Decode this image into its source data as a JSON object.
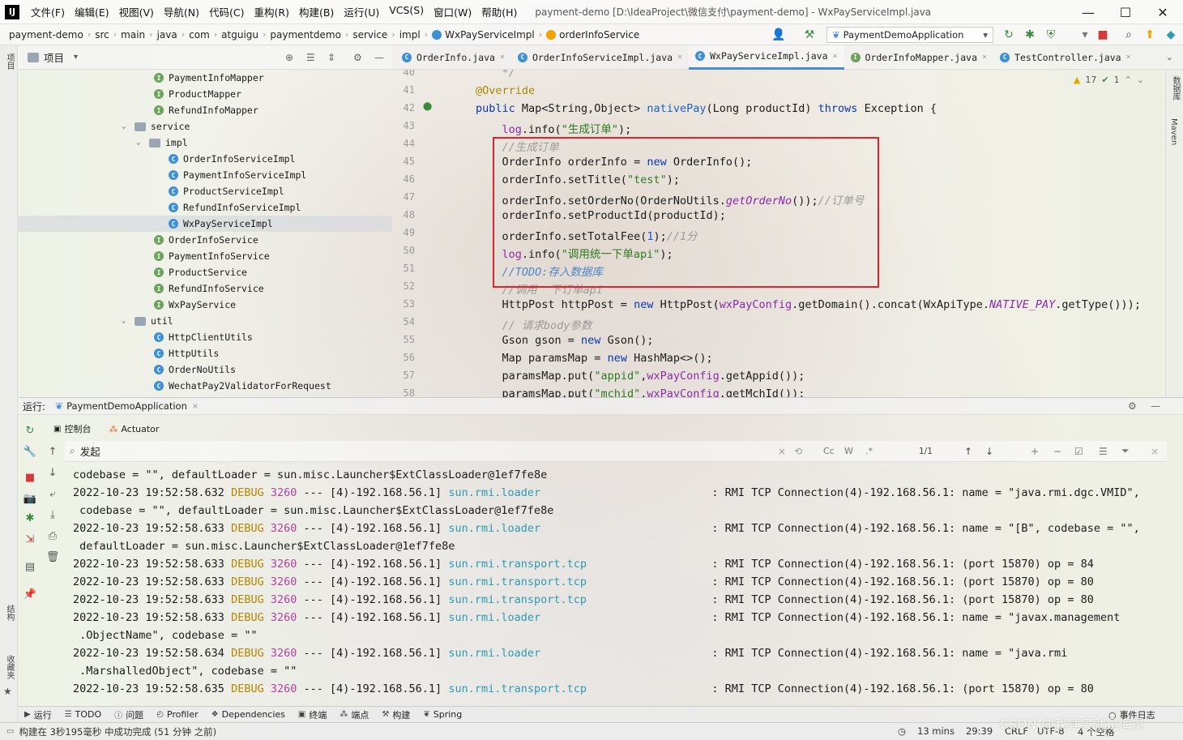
{
  "window": {
    "title": "payment-demo [D:\\IdeaProject\\微信支付\\payment-demo] - WxPayServiceImpl.java",
    "logo": "IJ",
    "controls": {
      "minimize": "—",
      "maximize": "☐",
      "close": "✕"
    }
  },
  "menu": [
    "文件(F)",
    "编辑(E)",
    "视图(V)",
    "导航(N)",
    "代码(C)",
    "重构(R)",
    "构建(B)",
    "运行(U)",
    "VCS(S)",
    "窗口(W)",
    "帮助(H)"
  ],
  "breadcrumbs": [
    "payment-demo",
    "src",
    "main",
    "java",
    "com",
    "atguigu",
    "paymentdemo",
    "service",
    "impl",
    "WxPayServiceImpl",
    "orderInfoService"
  ],
  "run_config": "PaymentDemoApplication",
  "project_panel": {
    "title": "项目",
    "left_strip_label": "项目"
  },
  "tree": [
    {
      "label": "PaymentInfoMapper",
      "kind": "iface",
      "depth": 3
    },
    {
      "label": "ProductMapper",
      "kind": "iface",
      "depth": 3
    },
    {
      "label": "RefundInfoMapper",
      "kind": "iface",
      "depth": 3
    },
    {
      "label": "service",
      "kind": "folder",
      "depth": 2,
      "expanded": true
    },
    {
      "label": "impl",
      "kind": "folder",
      "depth": 3,
      "expanded": true
    },
    {
      "label": "OrderInfoServiceImpl",
      "kind": "cls",
      "depth": 4
    },
    {
      "label": "PaymentInfoServiceImpl",
      "kind": "cls",
      "depth": 4
    },
    {
      "label": "ProductServiceImpl",
      "kind": "cls",
      "depth": 4
    },
    {
      "label": "RefundInfoServiceImpl",
      "kind": "cls",
      "depth": 4
    },
    {
      "label": "WxPayServiceImpl",
      "kind": "cls",
      "depth": 4,
      "selected": true
    },
    {
      "label": "OrderInfoService",
      "kind": "iface",
      "depth": 3
    },
    {
      "label": "PaymentInfoService",
      "kind": "iface",
      "depth": 3
    },
    {
      "label": "ProductService",
      "kind": "iface",
      "depth": 3
    },
    {
      "label": "RefundInfoService",
      "kind": "iface",
      "depth": 3
    },
    {
      "label": "WxPayService",
      "kind": "iface",
      "depth": 3
    },
    {
      "label": "util",
      "kind": "folder",
      "depth": 2,
      "expanded": true
    },
    {
      "label": "HttpClientUtils",
      "kind": "cls",
      "depth": 3
    },
    {
      "label": "HttpUtils",
      "kind": "cls",
      "depth": 3
    },
    {
      "label": "OrderNoUtils",
      "kind": "cls",
      "depth": 3
    },
    {
      "label": "WechatPay2ValidatorForRequest",
      "kind": "cls",
      "depth": 3
    }
  ],
  "editor_tabs": [
    {
      "label": "OrderInfo.java",
      "active": false
    },
    {
      "label": "OrderInfoServiceImpl.java",
      "active": false
    },
    {
      "label": "WxPayServiceImpl.java",
      "active": true
    },
    {
      "label": "OrderInfoMapper.java",
      "active": false
    },
    {
      "label": "TestController.java",
      "active": false
    }
  ],
  "editor_status": {
    "warnings": "17",
    "ok": "1"
  },
  "code": [
    {
      "no": "40",
      "tokens": [
        [
          "cm",
          "    */"
        ]
      ]
    },
    {
      "no": "41",
      "tokens": [
        [
          "an",
          "@Override"
        ]
      ]
    },
    {
      "no": "42",
      "tokens": [
        [
          "kw",
          "public "
        ],
        [
          "",
          "Map<String,Object> "
        ],
        [
          "fn",
          "nativePay"
        ],
        [
          "",
          "(Long productId) "
        ],
        [
          "kw",
          "throws "
        ],
        [
          "",
          "Exception {"
        ]
      ]
    },
    {
      "no": "43",
      "tokens": [
        [
          "",
          "    "
        ],
        [
          "fld",
          "log"
        ],
        [
          "",
          ".info("
        ],
        [
          "st",
          "\"生成订单\""
        ],
        [
          "",
          ");"
        ]
      ]
    },
    {
      "no": "44",
      "tokens": [
        [
          "cm",
          "    //生成订单"
        ]
      ]
    },
    {
      "no": "45",
      "tokens": [
        [
          "",
          "    OrderInfo orderInfo = "
        ],
        [
          "kw",
          "new "
        ],
        [
          "",
          "OrderInfo();"
        ]
      ]
    },
    {
      "no": "46",
      "tokens": [
        [
          "",
          "    orderInfo.setTitle("
        ],
        [
          "st",
          "\"test\""
        ],
        [
          "",
          ");"
        ]
      ]
    },
    {
      "no": "47",
      "tokens": [
        [
          "",
          "    orderInfo.setOrderNo(OrderNoUtils."
        ],
        [
          "cst",
          "getOrderNo"
        ],
        [
          "",
          "());"
        ],
        [
          "cm",
          "//订单号"
        ]
      ]
    },
    {
      "no": "48",
      "tokens": [
        [
          "",
          "    orderInfo.setProductId(productId);"
        ]
      ]
    },
    {
      "no": "49",
      "tokens": [
        [
          "",
          "    orderInfo.setTotalFee("
        ],
        [
          "num",
          "1"
        ],
        [
          "",
          ");"
        ],
        [
          "cm",
          "//1分"
        ]
      ]
    },
    {
      "no": "50",
      "tokens": [
        [
          "",
          "    "
        ],
        [
          "fld",
          "log"
        ],
        [
          "",
          ".info("
        ],
        [
          "st",
          "\"调用统一下单api\""
        ],
        [
          "",
          ");"
        ]
      ]
    },
    {
      "no": "51",
      "tokens": [
        [
          "todo",
          "    //TODO:存入数据库"
        ]
      ]
    },
    {
      "no": "52",
      "tokens": [
        [
          "cm",
          "    //调用  下订单api"
        ]
      ]
    },
    {
      "no": "53",
      "tokens": [
        [
          "",
          "    HttpPost httpPost = "
        ],
        [
          "kw",
          "new "
        ],
        [
          "",
          "HttpPost("
        ],
        [
          "fld",
          "wxPayConfig"
        ],
        [
          "",
          ".getDomain().concat(WxApiType."
        ],
        [
          "cst",
          "NATIVE_PAY"
        ],
        [
          "",
          ".getType()));"
        ]
      ]
    },
    {
      "no": "54",
      "tokens": [
        [
          "cm",
          "    // 请求body参数"
        ]
      ]
    },
    {
      "no": "55",
      "tokens": [
        [
          "",
          "    Gson gson = "
        ],
        [
          "kw",
          "new "
        ],
        [
          "",
          "Gson();"
        ]
      ]
    },
    {
      "no": "56",
      "tokens": [
        [
          "",
          "    Map paramsMap = "
        ],
        [
          "kw",
          "new "
        ],
        [
          "",
          "HashMap<>();"
        ]
      ]
    },
    {
      "no": "57",
      "tokens": [
        [
          "",
          "    paramsMap.put("
        ],
        [
          "st",
          "\"appid\""
        ],
        [
          "",
          ","
        ],
        [
          "fld",
          "wxPayConfig"
        ],
        [
          "",
          ".getAppid());"
        ]
      ]
    },
    {
      "no": "58",
      "tokens": [
        [
          "",
          "    paramsMap.put("
        ],
        [
          "st",
          "\"mchid\""
        ],
        [
          "",
          ","
        ],
        [
          "fld",
          "wxPayConfig"
        ],
        [
          "",
          ".getMchId());"
        ]
      ]
    }
  ],
  "run_panel": {
    "label": "运行:",
    "tab": "PaymentDemoApplication",
    "subtabs": [
      "控制台",
      "Actuator"
    ],
    "find_value": "发起",
    "find_count": "1/1",
    "find_opts": [
      "Cc",
      "W",
      ".*"
    ]
  },
  "console": [
    [
      [
        "",
        "codebase = \"\", defaultLoader = sun.misc.Launcher$ExtClassLoader@1ef7fe8e"
      ]
    ],
    [
      [
        "",
        "2022-10-23 19:52:58.632 "
      ],
      [
        "lvl",
        "DEBUG "
      ],
      [
        "pid",
        "3260"
      ],
      [
        "",
        " --- [4)-192.168.56.1] "
      ],
      [
        "lgr",
        "sun.rmi.loader                          "
      ],
      [
        "",
        ": RMI TCP Connection(4)-192.168.56.1: name = \"java.rmi.dgc.VMID\","
      ]
    ],
    [
      [
        "",
        " codebase = \"\", defaultLoader = sun.misc.Launcher$ExtClassLoader@1ef7fe8e"
      ]
    ],
    [
      [
        "",
        "2022-10-23 19:52:58.633 "
      ],
      [
        "lvl",
        "DEBUG "
      ],
      [
        "pid",
        "3260"
      ],
      [
        "",
        " --- [4)-192.168.56.1] "
      ],
      [
        "lgr",
        "sun.rmi.loader                          "
      ],
      [
        "",
        ": RMI TCP Connection(4)-192.168.56.1: name = \"[B\", codebase = \"\","
      ]
    ],
    [
      [
        "",
        " defaultLoader = sun.misc.Launcher$ExtClassLoader@1ef7fe8e"
      ]
    ],
    [
      [
        "",
        "2022-10-23 19:52:58.633 "
      ],
      [
        "lvl",
        "DEBUG "
      ],
      [
        "pid",
        "3260"
      ],
      [
        "",
        " --- [4)-192.168.56.1] "
      ],
      [
        "lgr",
        "sun.rmi.transport.tcp                   "
      ],
      [
        "",
        ": RMI TCP Connection(4)-192.168.56.1: (port 15870) op = 84"
      ]
    ],
    [
      [
        "",
        "2022-10-23 19:52:58.633 "
      ],
      [
        "lvl",
        "DEBUG "
      ],
      [
        "pid",
        "3260"
      ],
      [
        "",
        " --- [4)-192.168.56.1] "
      ],
      [
        "lgr",
        "sun.rmi.transport.tcp                   "
      ],
      [
        "",
        ": RMI TCP Connection(4)-192.168.56.1: (port 15870) op = 80"
      ]
    ],
    [
      [
        "",
        "2022-10-23 19:52:58.633 "
      ],
      [
        "lvl",
        "DEBUG "
      ],
      [
        "pid",
        "3260"
      ],
      [
        "",
        " --- [4)-192.168.56.1] "
      ],
      [
        "lgr",
        "sun.rmi.transport.tcp                   "
      ],
      [
        "",
        ": RMI TCP Connection(4)-192.168.56.1: (port 15870) op = 80"
      ]
    ],
    [
      [
        "",
        "2022-10-23 19:52:58.633 "
      ],
      [
        "lvl",
        "DEBUG "
      ],
      [
        "pid",
        "3260"
      ],
      [
        "",
        " --- [4)-192.168.56.1] "
      ],
      [
        "lgr",
        "sun.rmi.loader                          "
      ],
      [
        "",
        ": RMI TCP Connection(4)-192.168.56.1: name = \"javax.management"
      ]
    ],
    [
      [
        "",
        " .ObjectName\", codebase = \"\""
      ]
    ],
    [
      [
        "",
        "2022-10-23 19:52:58.634 "
      ],
      [
        "lvl",
        "DEBUG "
      ],
      [
        "pid",
        "3260"
      ],
      [
        "",
        " --- [4)-192.168.56.1] "
      ],
      [
        "lgr",
        "sun.rmi.loader                          "
      ],
      [
        "",
        ": RMI TCP Connection(4)-192.168.56.1: name = \"java.rmi"
      ]
    ],
    [
      [
        "",
        " .MarshalledObject\", codebase = \"\""
      ]
    ],
    [
      [
        "",
        "2022-10-23 19:52:58.635 "
      ],
      [
        "lvl",
        "DEBUG "
      ],
      [
        "pid",
        "3260"
      ],
      [
        "",
        " --- [4)-192.168.56.1] "
      ],
      [
        "lgr",
        "sun.rmi.transport.tcp                   "
      ],
      [
        "",
        ": RMI TCP Connection(4)-192.168.56.1: (port 15870) op = 80"
      ]
    ]
  ],
  "bottom_tabs": [
    {
      "label": "运行",
      "icon": "▶"
    },
    {
      "label": "TODO",
      "icon": "☰"
    },
    {
      "label": "问题",
      "icon": "ⓘ"
    },
    {
      "label": "Profiler",
      "icon": "◴"
    },
    {
      "label": "Dependencies",
      "icon": "❖"
    },
    {
      "label": "终端",
      "icon": "▣"
    },
    {
      "label": "端点",
      "icon": "⁂"
    },
    {
      "label": "构建",
      "icon": "⚒"
    },
    {
      "label": "Spring",
      "icon": "❦"
    }
  ],
  "event_log": "事件日志",
  "status": {
    "message": "构建在 3秒195毫秒 中成功完成 (51 分钟 之前)",
    "time": "13 mins",
    "position": "29:39",
    "line_sep": "CRLF",
    "encoding": "UTF-8",
    "indent": "4 个空格"
  },
  "watermark": "CSDN @我其实就是海员",
  "side_labels": {
    "structure": "结构",
    "favorites": "收藏夹",
    "database": "数据库",
    "maven": "Maven"
  }
}
